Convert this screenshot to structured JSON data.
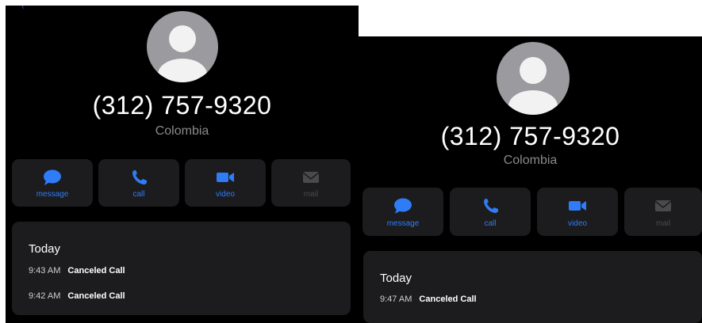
{
  "screens": [
    {
      "phone_number": "(312) 757-9320",
      "location": "Colombia",
      "actions": [
        {
          "label": "message",
          "icon": "message-bubble-icon",
          "enabled": true
        },
        {
          "label": "call",
          "icon": "phone-icon",
          "enabled": true
        },
        {
          "label": "video",
          "icon": "video-camera-icon",
          "enabled": true
        },
        {
          "label": "mail",
          "icon": "envelope-icon",
          "enabled": false
        }
      ],
      "history": {
        "heading": "Today",
        "calls": [
          {
            "time": "9:43 AM",
            "status": "Canceled Call"
          },
          {
            "time": "9:42 AM",
            "status": "Canceled Call"
          }
        ]
      }
    },
    {
      "phone_number": "(312) 757-9320",
      "location": "Colombia",
      "actions": [
        {
          "label": "message",
          "icon": "message-bubble-icon",
          "enabled": true
        },
        {
          "label": "call",
          "icon": "phone-icon",
          "enabled": true
        },
        {
          "label": "video",
          "icon": "video-camera-icon",
          "enabled": true
        },
        {
          "label": "mail",
          "icon": "envelope-icon",
          "enabled": false
        }
      ],
      "history": {
        "heading": "Today",
        "calls": [
          {
            "time": "9:47 AM",
            "status": "Canceled Call"
          }
        ]
      }
    }
  ],
  "colors": {
    "background": "#000000",
    "card": "#1c1c1e",
    "accent": "#2f7cf6",
    "secondary_text": "#8a8a8e",
    "disabled": "#4a4a4d"
  }
}
